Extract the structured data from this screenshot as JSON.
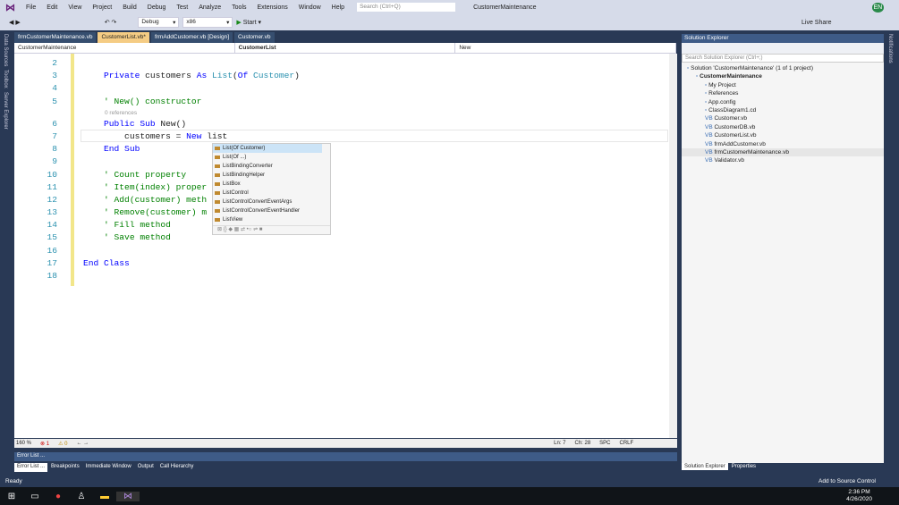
{
  "menu": [
    "File",
    "Edit",
    "View",
    "Project",
    "Build",
    "Debug",
    "Test",
    "Analyze",
    "Tools",
    "Extensions",
    "Window",
    "Help"
  ],
  "search_placeholder": "Search (Ctrl+Q)",
  "window_title": "CustomerMaintenance",
  "user_initials": "EN",
  "live_share": "Live Share",
  "toolbar": {
    "config": "Debug",
    "platform": "x86",
    "start": "Start"
  },
  "side_left": [
    "Data Sources",
    "Toolbox",
    "Server Explorer"
  ],
  "notifications": "Notifications",
  "tabs": [
    {
      "label": "frmCustomerMaintenance.vb",
      "active": false
    },
    {
      "label": "CustomerList.vb*",
      "active": true
    },
    {
      "label": "frmAddCustomer.vb [Design]",
      "active": false
    },
    {
      "label": "Customer.vb",
      "active": false
    }
  ],
  "nav": {
    "project": "CustomerMaintenance",
    "class": "CustomerList",
    "member": "New"
  },
  "code": [
    {
      "n": "2",
      "tokens": []
    },
    {
      "n": "3",
      "tokens": [
        {
          "t": "    "
        },
        {
          "t": "Private",
          "c": "k"
        },
        {
          "t": " customers "
        },
        {
          "t": "As",
          "c": "k"
        },
        {
          "t": " "
        },
        {
          "t": "List",
          "c": "t"
        },
        {
          "t": "("
        },
        {
          "t": "Of",
          "c": "k"
        },
        {
          "t": " "
        },
        {
          "t": "Customer",
          "c": "t"
        },
        {
          "t": ")"
        }
      ]
    },
    {
      "n": "4",
      "tokens": []
    },
    {
      "n": "5",
      "tokens": [
        {
          "t": "    "
        },
        {
          "t": "' New() constructor",
          "c": "c"
        }
      ],
      "lens": "0 references"
    },
    {
      "n": "6",
      "tokens": [
        {
          "t": "    "
        },
        {
          "t": "Public Sub",
          "c": "k"
        },
        {
          "t": " New()"
        }
      ]
    },
    {
      "n": "7",
      "tokens": [
        {
          "t": "        customers = "
        },
        {
          "t": "New",
          "c": "k"
        },
        {
          "t": " list"
        }
      ]
    },
    {
      "n": "8",
      "tokens": [
        {
          "t": "    "
        },
        {
          "t": "End Sub",
          "c": "k"
        }
      ]
    },
    {
      "n": "9",
      "tokens": []
    },
    {
      "n": "10",
      "tokens": [
        {
          "t": "    "
        },
        {
          "t": "' Count property",
          "c": "c"
        }
      ]
    },
    {
      "n": "11",
      "tokens": [
        {
          "t": "    "
        },
        {
          "t": "' Item(index) proper",
          "c": "c"
        }
      ]
    },
    {
      "n": "12",
      "tokens": [
        {
          "t": "    "
        },
        {
          "t": "' Add(customer) meth",
          "c": "c"
        }
      ]
    },
    {
      "n": "13",
      "tokens": [
        {
          "t": "    "
        },
        {
          "t": "' Remove(customer) m",
          "c": "c"
        }
      ]
    },
    {
      "n": "14",
      "tokens": [
        {
          "t": "    "
        },
        {
          "t": "' Fill method",
          "c": "c"
        }
      ]
    },
    {
      "n": "15",
      "tokens": [
        {
          "t": "    "
        },
        {
          "t": "' Save method",
          "c": "c"
        }
      ]
    },
    {
      "n": "16",
      "tokens": []
    },
    {
      "n": "17",
      "tokens": [
        {
          "t": "End Class",
          "c": "k"
        }
      ]
    },
    {
      "n": "18",
      "tokens": []
    }
  ],
  "intellisense": [
    "List(Of Customer)",
    "List(Of ...)",
    "ListBindingConverter",
    "ListBindingHelper",
    "ListBox",
    "ListControl",
    "ListControlConvertEventArgs",
    "ListControlConvertEventHandler",
    "ListView"
  ],
  "editor_status": {
    "zoom": "160 %",
    "errors": "1",
    "warnings": "0",
    "line": "Ln: 7",
    "col": "Ch: 28",
    "spc": "SPC",
    "crlf": "CRLF"
  },
  "error_panel_title": "Error List ...",
  "bottom_tabs": [
    "Error List ...",
    "Breakpoints",
    "Immediate Window",
    "Output",
    "Call Hierarchy"
  ],
  "solution_explorer": {
    "title": "Solution Explorer",
    "search": "Search Solution Explorer (Ctrl+;)",
    "items": [
      {
        "label": "Solution 'CustomerMaintenance' (1 of 1 project)",
        "indent": 0
      },
      {
        "label": "CustomerMaintenance",
        "indent": 1,
        "bold": true
      },
      {
        "label": "My Project",
        "indent": 2
      },
      {
        "label": "References",
        "indent": 2
      },
      {
        "label": "App.config",
        "indent": 2
      },
      {
        "label": "ClassDiagram1.cd",
        "indent": 2
      },
      {
        "label": "Customer.vb",
        "indent": 2
      },
      {
        "label": "CustomerDB.vb",
        "indent": 2
      },
      {
        "label": "CustomerList.vb",
        "indent": 2
      },
      {
        "label": "frmAddCustomer.vb",
        "indent": 2
      },
      {
        "label": "frmCustomerMaintenance.vb",
        "indent": 2,
        "selected": true
      },
      {
        "label": "Validator.vb",
        "indent": 2
      }
    ],
    "tabs": [
      "Solution Explorer",
      "Properties"
    ]
  },
  "status": {
    "ready": "Ready",
    "source_control": "Add to Source Control"
  },
  "clock": {
    "time": "2:36 PM",
    "date": "4/26/2020"
  }
}
